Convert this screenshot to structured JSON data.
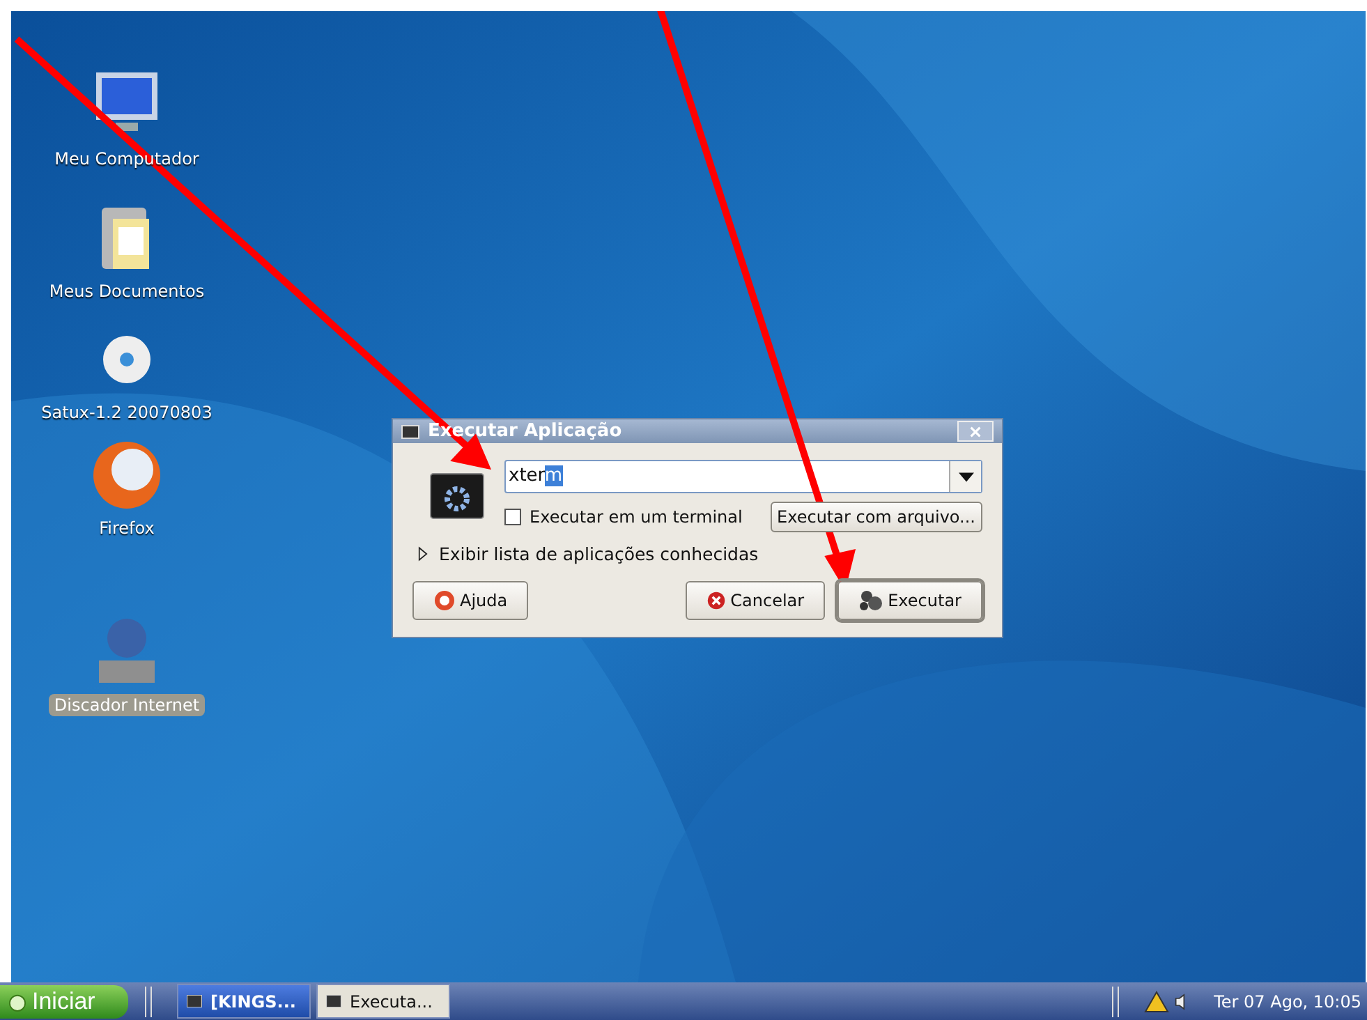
{
  "desktop_icons": [
    {
      "label": "Meu Computador",
      "kind": "computer",
      "selected": false
    },
    {
      "label": "Meus Documentos",
      "kind": "documents",
      "selected": false
    },
    {
      "label": "Satux-1.2 20070803",
      "kind": "dvd",
      "selected": false
    },
    {
      "label": "Firefox",
      "kind": "browser",
      "selected": false
    },
    {
      "label": "Discador Internet",
      "kind": "dialer",
      "selected": true
    }
  ],
  "dialog": {
    "title": "Executar Aplicação",
    "command": {
      "text": "xter",
      "selected_text": "m"
    },
    "terminal_checkbox": {
      "label": "Executar em um terminal",
      "checked": false
    },
    "file_button": "Executar com arquivo...",
    "expander": {
      "label": "Exibir lista de aplicações conhecidas",
      "expanded": false
    },
    "buttons": [
      {
        "label": "Ajuda",
        "kind": "help",
        "default": false
      },
      {
        "label": "Cancelar",
        "kind": "cancel",
        "default": false
      },
      {
        "label": "Executar",
        "kind": "run",
        "default": true
      }
    ]
  },
  "taskbar": {
    "start": "Iniciar",
    "tasks": [
      {
        "label": "[KINGS...",
        "selected": false
      },
      {
        "label": "Executa...",
        "selected": true
      }
    ],
    "clock": "Ter 07 Ago, 10:05"
  }
}
